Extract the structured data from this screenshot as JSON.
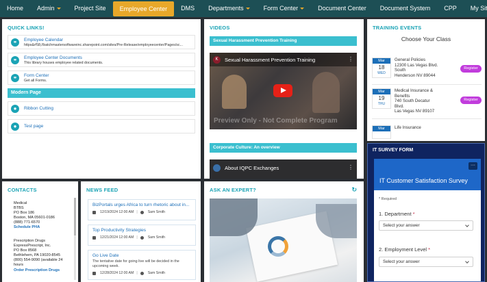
{
  "nav": [
    {
      "label": "Home",
      "caret": false,
      "active": false
    },
    {
      "label": "Admin",
      "caret": true,
      "active": false
    },
    {
      "label": "Project Site",
      "caret": false,
      "active": false
    },
    {
      "label": "Employee Center",
      "caret": false,
      "active": true
    },
    {
      "label": "DMS",
      "caret": false,
      "active": false
    },
    {
      "label": "Departments",
      "caret": true,
      "active": false
    },
    {
      "label": "Form Center",
      "caret": true,
      "active": false
    },
    {
      "label": "Document Center",
      "caret": false,
      "active": false
    },
    {
      "label": "Document System",
      "caret": false,
      "active": false
    },
    {
      "label": "CPP",
      "caret": false,
      "active": false
    },
    {
      "label": "My Site",
      "caret": false,
      "active": false
    }
  ],
  "quick_links": {
    "title": "QUICK LINKS!",
    "items": [
      {
        "name": "Employee Calendar",
        "desc": "https&#58;//batchmastersoftwareinc.sharepoint.com/sites/Pre-Release/employeecenter/Pages/sc..."
      },
      {
        "name": "Employee Center Documents",
        "desc": "This library houses employee related documents."
      },
      {
        "name": "Form Center",
        "desc": "Get all Forms."
      }
    ],
    "section": "Modern Page",
    "section_items": [
      {
        "name": "Ribbon Cutting"
      },
      {
        "name": "Test page"
      }
    ]
  },
  "videos": {
    "title": "VIDEOS",
    "video1_bar": "Sexual Harassment Prevention Training",
    "video1_title": "Sexual Harassment Prevention Training",
    "video1_watermark": "Preview Only - Not Complete Program",
    "video2_bar": "Corporate Culture: An overview",
    "video2_title": "About IQPC Exchanges"
  },
  "training": {
    "title": "TRAINING EVENTS",
    "subtitle": "Choose Your Class",
    "events": [
      {
        "month": "Mar",
        "day": "18",
        "weekday": "WED",
        "lines": [
          "General Policies",
          "12300 Las Vegas Blvd.",
          "South",
          "Henderson NV 89044"
        ],
        "button": "Register"
      },
      {
        "month": "Mar",
        "day": "19",
        "weekday": "THU",
        "lines": [
          "Medical Insurance &",
          "Benefits",
          "740 South Decatur",
          "Blvd.",
          "Las Vegas NV 89107"
        ],
        "button": "Register"
      },
      {
        "month": "Mar",
        "day": "",
        "weekday": "",
        "lines": [
          "Life Insurance"
        ],
        "button": ""
      }
    ]
  },
  "survey": {
    "title": "IT SURVEY FORM",
    "form_title": "IT Customer Satisfaction Survey",
    "required": "* Required",
    "q1": "1. Department",
    "q1_value": "Select your answer",
    "q2": "2. Employment Level",
    "q2_value": "Select your answer",
    "more": "···"
  },
  "contacts": {
    "title": "CONTACTS",
    "items": [
      {
        "lines": [
          "Medical",
          "BTBS",
          "PO Box 186",
          "Boston, MA 05601-0186",
          "(888) 771-6570"
        ],
        "link": "Schedule PHA"
      },
      {
        "lines": [
          "Prescription Drugs",
          "ExpressPrescript, Inc.",
          "PO Box 8568",
          "Bethlehem, PA 19020-8545",
          "(800) 554-9090 (available 24",
          "hours"
        ],
        "link": "Order Prescription Drugs"
      }
    ]
  },
  "news": {
    "title": "NEWS FEED",
    "items": [
      {
        "title": "BizPortals urges Africa to turn rhetoric about in...",
        "desc": "",
        "date": "12/19/2024 12:00 AM",
        "author": "Sam Smith"
      },
      {
        "title": "Top Productivity Strategies",
        "desc": "",
        "date": "12/21/2024 12:00 AM",
        "author": "Sam Smith"
      },
      {
        "title": "Go Live Date",
        "desc": "The tentative date for going live will be decided in the upcoming week.",
        "date": "12/28/2024 12:00 AM",
        "author": "Sam Smith"
      }
    ]
  },
  "expert": {
    "title": "ASK AN EXPERT?"
  },
  "colors": {
    "nav_bg": "#1d4f55",
    "nav_active": "#e8a82a",
    "accent": "#1aa3b5",
    "link": "#1c6fb8",
    "register": "#c13cdc",
    "survey_bg": "#0f2460"
  }
}
